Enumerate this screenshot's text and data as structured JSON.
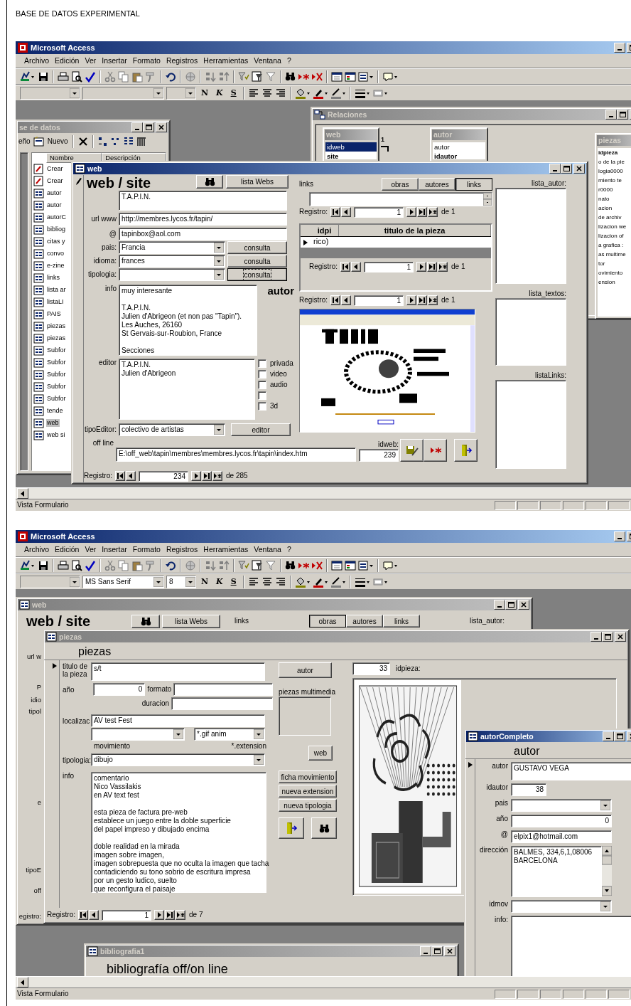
{
  "page_title": "BASE DE DATOS EXPERIMENTAL",
  "screens": [
    {
      "app_title": "Microsoft Access",
      "menu": [
        "Archivo",
        "Edición",
        "Ver",
        "Insertar",
        "Formato",
        "Registros",
        "Herramientas",
        "Ventana",
        "?"
      ],
      "format_toolbar": {
        "buttons": [
          "N",
          "K",
          "S"
        ]
      },
      "status_bar": "Vista Formulario",
      "windows": [
        {
          "kind": "database",
          "title": "se de datos",
          "active": false,
          "toolbar": {
            "design": "eño",
            "new": "Nuevo"
          },
          "columns": [
            "Nombre",
            "Descripción"
          ],
          "items": [
            {
              "name": "Crear",
              "kind": "wizard",
              "selected": false
            },
            {
              "name": "Crear",
              "kind": "wizard",
              "selected": false
            },
            {
              "name": "autor",
              "kind": "form",
              "selected": false
            },
            {
              "name": "autor",
              "kind": "form",
              "selected": false
            },
            {
              "name": "autorC",
              "kind": "form",
              "selected": false
            },
            {
              "name": "bibliog",
              "kind": "form",
              "selected": false
            },
            {
              "name": "citas y",
              "kind": "form",
              "selected": false
            },
            {
              "name": "convo",
              "kind": "form",
              "selected": false
            },
            {
              "name": "e-zine",
              "kind": "form",
              "selected": false
            },
            {
              "name": "links",
              "kind": "form",
              "selected": false
            },
            {
              "name": "lista ar",
              "kind": "form",
              "selected": false
            },
            {
              "name": "listaLI",
              "kind": "form",
              "selected": false
            },
            {
              "name": "PAIS",
              "kind": "form",
              "selected": false
            },
            {
              "name": "piezas",
              "kind": "form",
              "selected": false
            },
            {
              "name": "piezas",
              "kind": "form",
              "selected": false
            },
            {
              "name": "Subfor",
              "kind": "form",
              "selected": false
            },
            {
              "name": "Subfor",
              "kind": "form",
              "selected": false
            },
            {
              "name": "Subfor",
              "kind": "form",
              "selected": false
            },
            {
              "name": "Subfor",
              "kind": "form",
              "selected": false
            },
            {
              "name": "Subfor",
              "kind": "form",
              "selected": false
            },
            {
              "name": "tende",
              "kind": "form",
              "selected": false
            },
            {
              "name": "web",
              "kind": "form",
              "selected": true
            },
            {
              "name": "web si",
              "kind": "form",
              "selected": false
            }
          ]
        },
        {
          "kind": "relations",
          "title": "Relaciones",
          "active": false,
          "join_label": "1",
          "tables": [
            {
              "title": "web",
              "fields": [
                {
                  "name": "idweb",
                  "key": false,
                  "selected": true
                },
                {
                  "name": "site",
                  "key": true,
                  "selected": false
                }
              ]
            },
            {
              "title": "autor",
              "fields": [
                {
                  "name": "autor",
                  "key": false,
                  "selected": false
                },
                {
                  "name": "idautor",
                  "key": true,
                  "selected": false
                }
              ]
            },
            {
              "title": "piezas",
              "fields": [
                {
                  "name": "idpieza",
                  "key": true,
                  "selected": false
                },
                {
                  "name": "o de la pie",
                  "key": false,
                  "selected": false
                },
                {
                  "name": "logia0000",
                  "key": false,
                  "selected": false
                },
                {
                  "name": "miento te",
                  "key": false,
                  "selected": false
                },
                {
                  "name": "r0000",
                  "key": false,
                  "selected": false
                },
                {
                  "name": "nato",
                  "key": false,
                  "selected": false
                },
                {
                  "name": "acion",
                  "key": false,
                  "selected": false
                },
                {
                  "name": "de archiv",
                  "key": false,
                  "selected": false
                },
                {
                  "name": "lizacion we",
                  "key": false,
                  "selected": false
                },
                {
                  "name": "lizacion of",
                  "key": false,
                  "selected": false
                },
                {
                  "name": "a grafica :",
                  "key": false,
                  "selected": false
                },
                {
                  "name": "as multime",
                  "key": false,
                  "selected": false
                },
                {
                  "name": "tor",
                  "key": false,
                  "selected": false
                },
                {
                  "name": "ovimiento",
                  "key": false,
                  "selected": false
                },
                {
                  "name": "ension",
                  "key": false,
                  "selected": false
                }
              ]
            }
          ]
        },
        {
          "kind": "web_form",
          "title": "web",
          "active": true,
          "heading": "web / site",
          "list_button": "lista Webs",
          "site": "T.A.P.I.N.",
          "fields": [
            {
              "label": "url www",
              "value": "http://membres.lycos.fr/tapin/"
            },
            {
              "label": "@",
              "value": "tapinbox@aol.com"
            }
          ],
          "combos": [
            {
              "label": "pais:",
              "value": "Francia",
              "button": "consulta",
              "focused": false
            },
            {
              "label": "idioma:",
              "value": "frances",
              "button": "consulta",
              "focused": false
            },
            {
              "label": "tipologia:",
              "button": "consulta",
              "focused": true
            }
          ],
          "autor_label": "autor",
          "info_label": "info",
          "info": "muy interesante\n\nT.A.P.I.N.\nJulien d'Abrigeon (et non pas \"Tapin\").\nLes Auches, 26160\nSt Gervais-sur-Roubion, France\n\nSecciones",
          "editor_label": "editor",
          "editor": "T.A.P.I.N.\nJulien d'Abrigeon",
          "checks": [
            {
              "label": "privada",
              "checked": false
            },
            {
              "label": "video",
              "checked": false
            },
            {
              "label": "audio",
              "checked": false
            },
            {
              "checked": false
            },
            {
              "label": "3d",
              "checked": false
            }
          ],
          "tipo_editor_label": "tipoEditor:",
          "tipo_editor": "colectivo de artistas",
          "editor_button": "editor",
          "offline_label": "off line",
          "offline": "E:\\off_web\\tapin\\membres\\membres.lycos.fr\\tapin\\index.htm",
          "idweb_label": "idweb:",
          "idweb": "239",
          "links_label": "links",
          "tabs": [
            {
              "label": "obras",
              "selected": false
            },
            {
              "label": "autores",
              "selected": false
            },
            {
              "label": "links",
              "selected": true
            }
          ],
          "sub_columns": [
            "idpi",
            "titulo de la pieza"
          ],
          "sub_row": "rico)",
          "middle_navs": [
            {
              "label": "Registro:",
              "value": "1",
              "count": "de 1"
            },
            {
              "label": "Registro:",
              "value": "1",
              "count": "de 1"
            },
            {
              "label": "Registro:",
              "value": "1",
              "count": "de 1"
            }
          ],
          "lists": [
            "lista_autor:",
            "lista_textos:",
            "listaLinks:"
          ],
          "nav": {
            "label": "Registro:",
            "value": "234",
            "count": "de 285"
          }
        }
      ]
    },
    {
      "app_title": "Microsoft Access",
      "menu": [
        "Archivo",
        "Edición",
        "Ver",
        "Insertar",
        "Formato",
        "Registros",
        "Herramientas",
        "Ventana",
        "?"
      ],
      "format_toolbar": {
        "font_box": "MS Sans Serif",
        "size_box": "8",
        "buttons": [
          "N",
          "K",
          "S"
        ]
      },
      "status_bar": "Vista Formulario",
      "windows": [
        {
          "kind": "web_behind",
          "title": "web",
          "active": false,
          "heading": "web / site",
          "list_button": "lista Webs",
          "links_label": "links",
          "tabs": [
            {
              "label": "obras",
              "selected": true
            },
            {
              "label": "autores",
              "selected": false
            },
            {
              "label": "links",
              "selected": false
            }
          ],
          "lista_autor_label": "lista_autor:",
          "cut_labels": [
            "url w",
            "P",
            "idio",
            "tipol",
            "e",
            "tipoE",
            "off",
            "egistro:"
          ]
        },
        {
          "kind": "piezas_form",
          "title": "piezas",
          "active": false,
          "heading": "piezas",
          "titulo_label": "titulo de la pieza",
          "titulo": "s/t",
          "autor_button": "autor",
          "anio_label": "año",
          "anio": "0",
          "formato_label": "formato",
          "duracion_label": "duracion",
          "multimedia_label": "piezas multimedia",
          "localizac_label": "localizac",
          "localizac": "AV test Fest",
          "extension": "*.gif anim",
          "movimiento_label": "movimiento",
          "extension_label": "*.extension",
          "web_button": "web",
          "tipologia_label": "tipologia:",
          "tipologia": "dibujo",
          "info_label": "info",
          "info": "comentario\nNico Vassilakis\nen AV text fest\n\nesta pieza de factura pre-web\nestablece un juego entre la doble superficie\ndel papel impreso y dibujado encima\n\ndoble realidad en la mirada\nimagen sobre imagen,\nimagen sobrepuesta que no oculta la imagen que tacha\ncontadiciendo su tono sobrio de escritura impresa\npor un gesto ludico, suelto\nque reconfigura el paisaje",
          "side_buttons": [
            "ficha movimiento",
            "nueva extension",
            "nueva tipologia"
          ],
          "idpieza": "33",
          "idpieza_label": "idpieza:",
          "nav": {
            "label": "Registro:",
            "value": "1",
            "count": "de 7"
          }
        },
        {
          "kind": "bibliography",
          "title": "bibliografia1",
          "active": false,
          "heading": "bibliografía off/on line"
        },
        {
          "kind": "autor_form",
          "title": "autorCompleto",
          "active": true,
          "heading": "autor",
          "fields": [
            {
              "label": "autor",
              "value": "GUSTAVO VEGA",
              "kind": "memo"
            },
            {
              "label": "idautor",
              "value": "38",
              "kind": "number"
            },
            {
              "label": "pais",
              "kind": "combo"
            },
            {
              "label": "año",
              "value": "0",
              "kind": "number_wide"
            },
            {
              "label": "@",
              "value": "elpix1@hotmail.com",
              "kind": "text"
            },
            {
              "label": "dirección",
              "value": "BALMES, 334,6,1,08006\nBARCELONA",
              "kind": "scroll_memo"
            },
            {
              "label": "idmov",
              "kind": "combo"
            },
            {
              "label": "info:",
              "kind": "memo_big"
            }
          ]
        }
      ]
    }
  ]
}
